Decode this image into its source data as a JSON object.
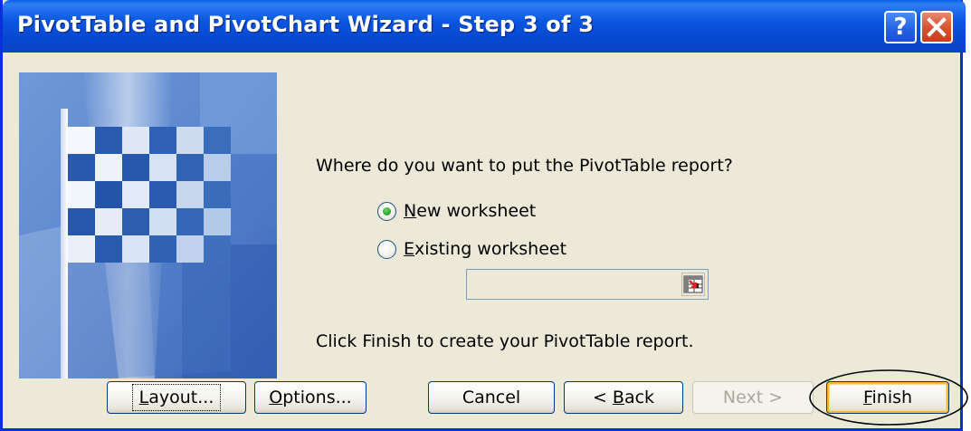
{
  "window": {
    "title": "PivotTable and PivotChart Wizard - Step 3 of 3",
    "help_label": "?",
    "close_label": "✕"
  },
  "main": {
    "prompt": "Where do you want to put the PivotTable report?",
    "options": [
      {
        "pre": "",
        "accel": "N",
        "post": "ew worksheet",
        "checked": true
      },
      {
        "pre": "",
        "accel": "E",
        "post": "xisting worksheet",
        "checked": false
      }
    ],
    "range_value": "",
    "finish_hint": "Click Finish to create your PivotTable report."
  },
  "buttons": {
    "layout": {
      "accel": "L",
      "rest": "ayout..."
    },
    "options": {
      "accel": "O",
      "rest": "ptions..."
    },
    "cancel": "Cancel",
    "back": {
      "pre": "< ",
      "accel": "B",
      "rest": "ack"
    },
    "next": "Next >",
    "finish": {
      "accel": "F",
      "rest": "inish"
    }
  },
  "colors": {
    "titlebar": "#0a56e0",
    "dialog_bg": "#ece9d8",
    "radio_checked": "#21a121",
    "focus_ring": "#f8b830"
  }
}
